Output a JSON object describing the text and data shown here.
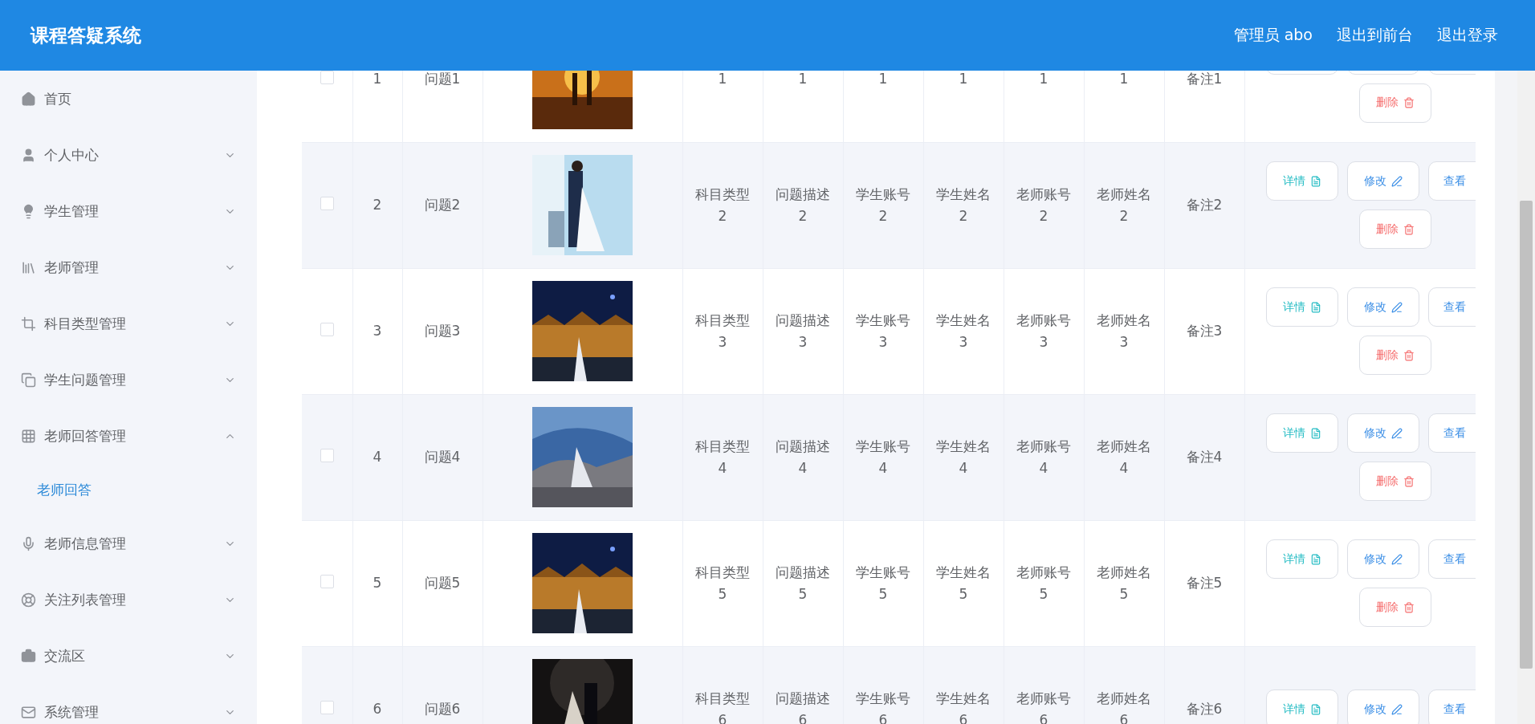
{
  "header": {
    "title": "课程答疑系统",
    "links": [
      "管理员 abo",
      "退出到前台",
      "退出登录"
    ]
  },
  "sidebar": {
    "items": [
      {
        "label": "首页",
        "kind": "link"
      },
      {
        "label": "个人中心",
        "kind": "menu",
        "expanded": false
      },
      {
        "label": "学生管理",
        "kind": "menu",
        "expanded": false
      },
      {
        "label": "老师管理",
        "kind": "menu",
        "expanded": false
      },
      {
        "label": "科目类型管理",
        "kind": "menu",
        "expanded": false
      },
      {
        "label": "学生问题管理",
        "kind": "menu",
        "expanded": false
      },
      {
        "label": "老师回答管理",
        "kind": "menu",
        "expanded": true,
        "children": [
          {
            "label": "老师回答",
            "selected": true
          }
        ]
      },
      {
        "label": "老师信息管理",
        "kind": "menu",
        "expanded": false
      },
      {
        "label": "关注列表管理",
        "kind": "menu",
        "expanded": false
      },
      {
        "label": "交流区",
        "kind": "menu",
        "expanded": false
      },
      {
        "label": "系统管理",
        "kind": "menu",
        "expanded": false
      }
    ]
  },
  "table": {
    "rows": [
      {
        "checked": false,
        "index": "1",
        "question": "问题1",
        "picture": {
          "kind": "picture"
        },
        "fields": [
          "1",
          "1",
          "1",
          "1",
          "1",
          "1"
        ],
        "note": "备注1",
        "actions": [
          {
            "kind": "detail"
          },
          {
            "kind": "edit"
          },
          {
            "kind": "view"
          },
          {
            "label": "删除",
            "kind": "delete"
          }
        ]
      },
      {
        "checked": false,
        "index": "2",
        "question": "问题2",
        "picture": {
          "kind": "picture"
        },
        "fields": [
          "科目类型2",
          "问题描述2",
          "学生账号2",
          "学生姓名2",
          "老师账号2",
          "老师姓名2"
        ],
        "note": "备注2",
        "actions": [
          {
            "label": "详情",
            "kind": "detail"
          },
          {
            "label": "修改",
            "kind": "edit"
          },
          {
            "label": "查看",
            "kind": "view"
          },
          {
            "label": "删除",
            "kind": "delete"
          }
        ]
      },
      {
        "checked": false,
        "index": "3",
        "question": "问题3",
        "picture": {
          "kind": "picture"
        },
        "fields": [
          "科目类型3",
          "问题描述3",
          "学生账号3",
          "学生姓名3",
          "老师账号3",
          "老师姓名3"
        ],
        "note": "备注3",
        "actions": [
          {
            "label": "详情",
            "kind": "detail"
          },
          {
            "label": "修改",
            "kind": "edit"
          },
          {
            "label": "查看",
            "kind": "view"
          },
          {
            "label": "删除",
            "kind": "delete"
          }
        ]
      },
      {
        "checked": false,
        "index": "4",
        "question": "问题4",
        "picture": {
          "kind": "picture"
        },
        "fields": [
          "科目类型4",
          "问题描述4",
          "学生账号4",
          "学生姓名4",
          "老师账号4",
          "老师姓名4"
        ],
        "note": "备注4",
        "actions": [
          {
            "label": "详情",
            "kind": "detail"
          },
          {
            "label": "修改",
            "kind": "edit"
          },
          {
            "label": "查看",
            "kind": "view"
          },
          {
            "label": "删除",
            "kind": "delete"
          }
        ]
      },
      {
        "checked": false,
        "index": "5",
        "question": "问题5",
        "picture": {
          "kind": "picture"
        },
        "fields": [
          "科目类型5",
          "问题描述5",
          "学生账号5",
          "学生姓名5",
          "老师账号5",
          "老师姓名5"
        ],
        "note": "备注5",
        "actions": [
          {
            "label": "详情",
            "kind": "detail"
          },
          {
            "label": "修改",
            "kind": "edit"
          },
          {
            "label": "查看",
            "kind": "view"
          },
          {
            "label": "删除",
            "kind": "delete"
          }
        ]
      },
      {
        "checked": false,
        "index": "6",
        "question": "问题6",
        "picture": {
          "kind": "picture"
        },
        "fields": [
          "科目类型6",
          "问题描述6",
          "学生账号6",
          "学生姓名6",
          "老师账号6",
          "老师姓名6"
        ],
        "note": "备注6",
        "actions": [
          {
            "label": "详情",
            "kind": "detail"
          },
          {
            "label": "修改",
            "kind": "edit"
          },
          {
            "label": "查看",
            "kind": "view"
          }
        ]
      }
    ]
  }
}
